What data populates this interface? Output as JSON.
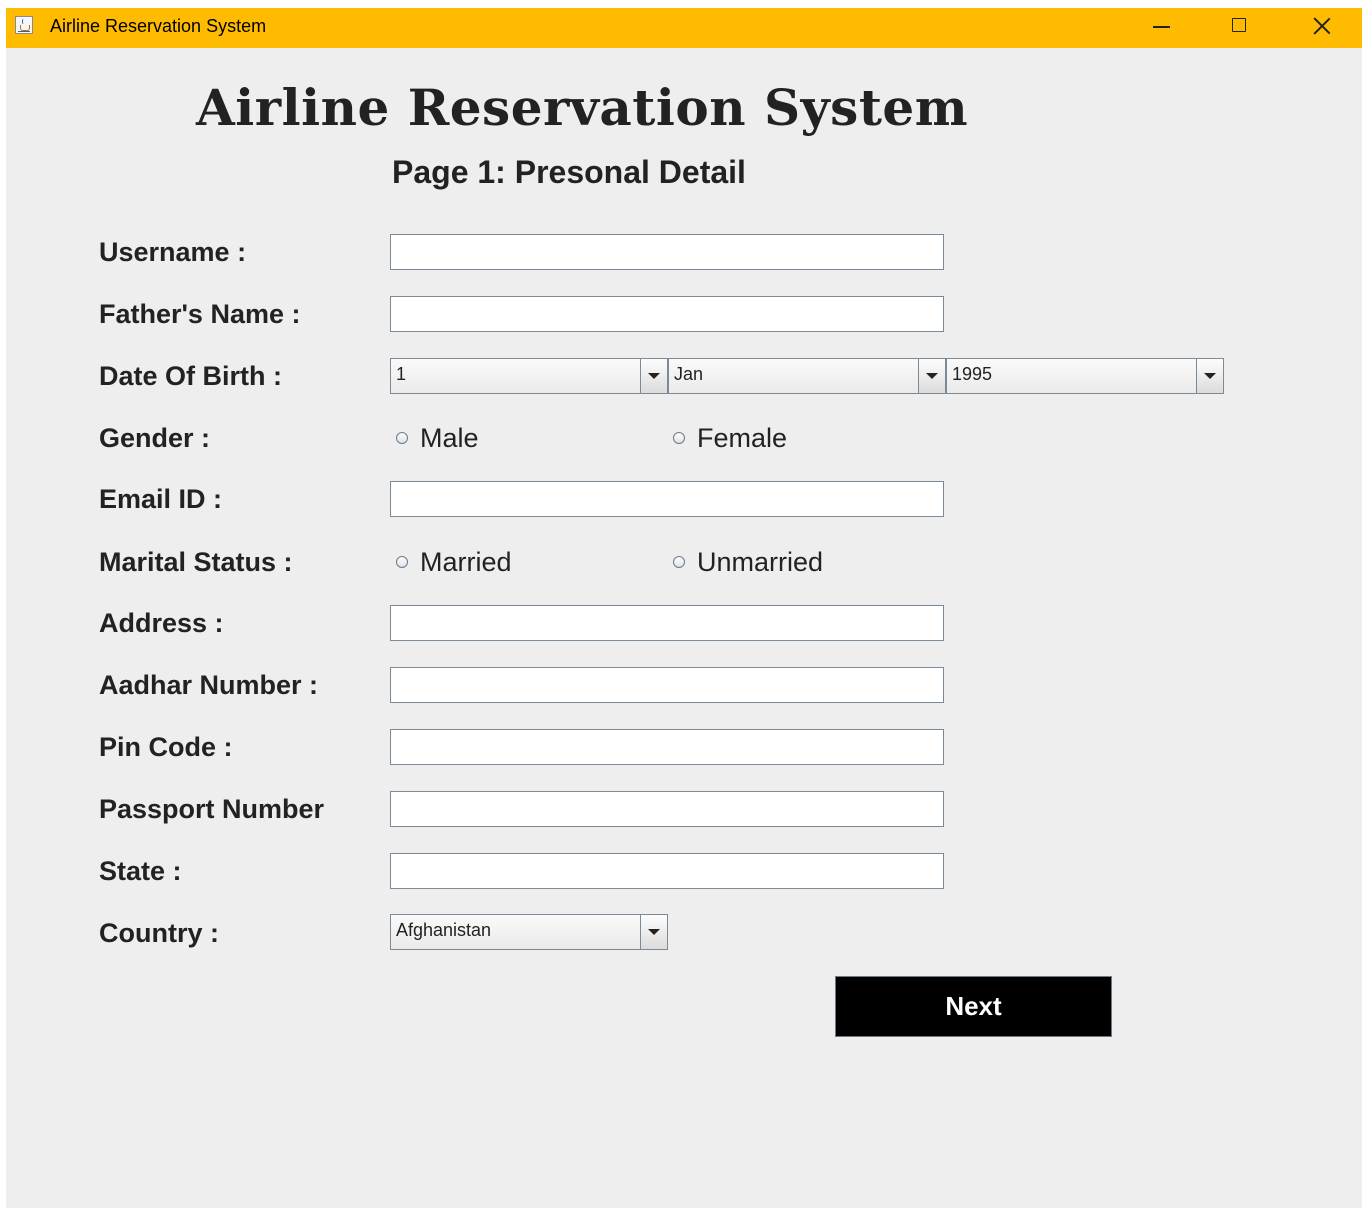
{
  "window": {
    "title": "Airline Reservation System",
    "titlebar_color": "#ffbb00",
    "background_color": "#eeeeee",
    "controls": [
      "minimize-icon",
      "maximize-icon",
      "close-icon"
    ]
  },
  "header": {
    "title": "Airline Reservation System",
    "subtitle": "Page 1: Presonal Detail"
  },
  "form": {
    "username": {
      "label": "Username :",
      "value": ""
    },
    "father_name": {
      "label": "Father's Name :",
      "value": ""
    },
    "dob": {
      "label": "Date Of Birth :",
      "day": "1",
      "month": "Jan",
      "year": "1995"
    },
    "gender": {
      "label": "Gender :",
      "options": [
        "Male",
        "Female"
      ],
      "selected": null
    },
    "email": {
      "label": "Email ID :",
      "value": ""
    },
    "marital_status": {
      "label": "Marital Status :",
      "options": [
        "Married",
        "Unmarried"
      ],
      "selected": null
    },
    "address": {
      "label": "Address :",
      "value": ""
    },
    "aadhar": {
      "label": "Aadhar Number :",
      "value": ""
    },
    "pin_code": {
      "label": "Pin Code :",
      "value": ""
    },
    "passport": {
      "label": "Passport Number",
      "value": ""
    },
    "state": {
      "label": "State :",
      "value": ""
    },
    "country": {
      "label": "Country :",
      "selected": "Afghanistan"
    }
  },
  "actions": {
    "next_label": "Next",
    "next_color": "#000000"
  }
}
